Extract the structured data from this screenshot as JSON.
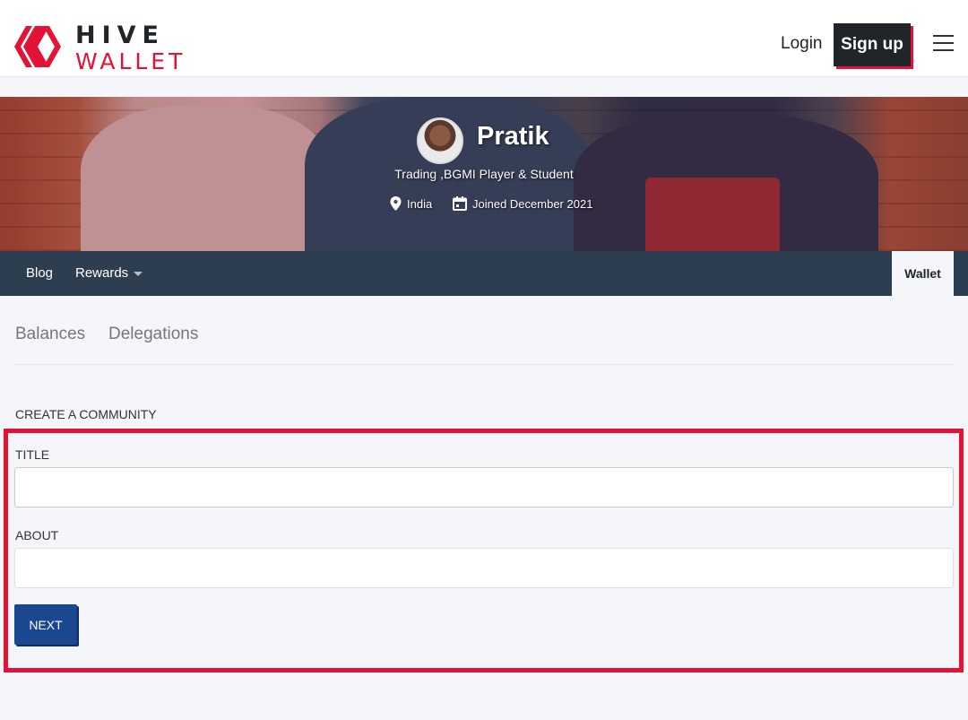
{
  "brand": {
    "name_top": "HIVE",
    "name_bottom": "WALLET",
    "accent_color": "#e31337"
  },
  "header": {
    "login_label": "Login",
    "signup_label": "Sign up",
    "menu_icon": "hamburger-menu-icon"
  },
  "profile": {
    "name": "Pratik",
    "about": "Trading ,BGMI Player & Student",
    "location": "India",
    "joined": "Joined December 2021",
    "location_icon": "map-pin-icon",
    "calendar_icon": "calendar-icon"
  },
  "nav": {
    "blog_label": "Blog",
    "rewards_label": "Rewards",
    "wallet_label": "Wallet",
    "bar_color": "#2c3e50"
  },
  "wallet_tabs": {
    "balances_label": "Balances",
    "delegations_label": "Delegations"
  },
  "form": {
    "heading": "CREATE A COMMUNITY",
    "title_label": "TITLE",
    "title_value": "",
    "about_label": "ABOUT",
    "about_value": "",
    "next_label": "NEXT",
    "button_color": "#1a4790"
  }
}
